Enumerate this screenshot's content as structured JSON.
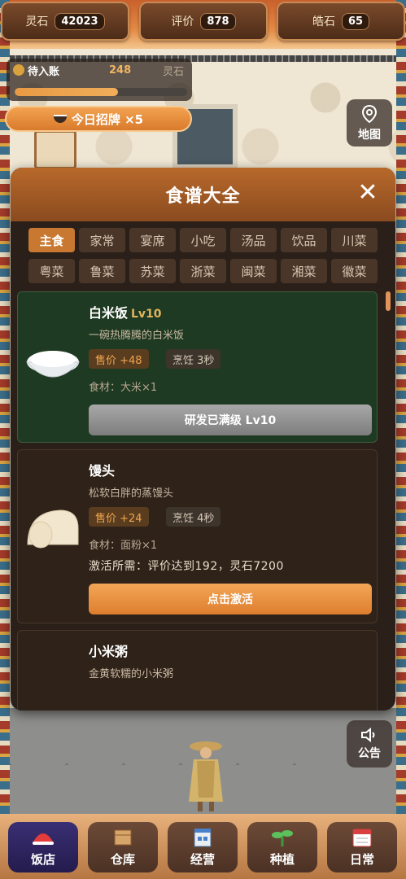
{
  "currencies": [
    {
      "label": "灵石",
      "value": "42023"
    },
    {
      "label": "评价",
      "value": "878"
    },
    {
      "label": "皓石",
      "value": "65"
    }
  ],
  "pending": {
    "label": "待入账",
    "amount": "248",
    "unit": "灵石",
    "progress": 0.6
  },
  "recruit": {
    "label": "今日招牌 ×5"
  },
  "side_buttons": {
    "map": "地图",
    "notice": "公告"
  },
  "modal": {
    "title": "食谱大全",
    "close": "✕",
    "categories": [
      "主食",
      "家常",
      "宴席",
      "小吃",
      "汤品",
      "饮品",
      "川菜",
      "粤菜",
      "鲁菜",
      "苏菜",
      "浙菜",
      "闽菜",
      "湘菜",
      "徽菜"
    ],
    "active_category": "主食",
    "recipes": [
      {
        "name": "白米饭",
        "level": "Lv10",
        "desc": "一碗热腾腾的白米饭",
        "price": "售价 +48",
        "cook": "烹饪 3秒",
        "ingredients": "食材：大米×1",
        "action": "研发已满级 Lv10"
      },
      {
        "name": "馒头",
        "desc": "松软白胖的蒸馒头",
        "price": "售价 +24",
        "cook": "烹饪 4秒",
        "ingredients": "食材：面粉×1",
        "requirement": "激活所需：评价达到192，灵石7200",
        "action": "点击激活"
      },
      {
        "name": "小米粥",
        "desc": "金黄软糯的小米粥"
      }
    ]
  },
  "nav": [
    {
      "label": "饭店",
      "active": true
    },
    {
      "label": "仓库"
    },
    {
      "label": "经营"
    },
    {
      "label": "种植"
    },
    {
      "label": "日常"
    }
  ]
}
